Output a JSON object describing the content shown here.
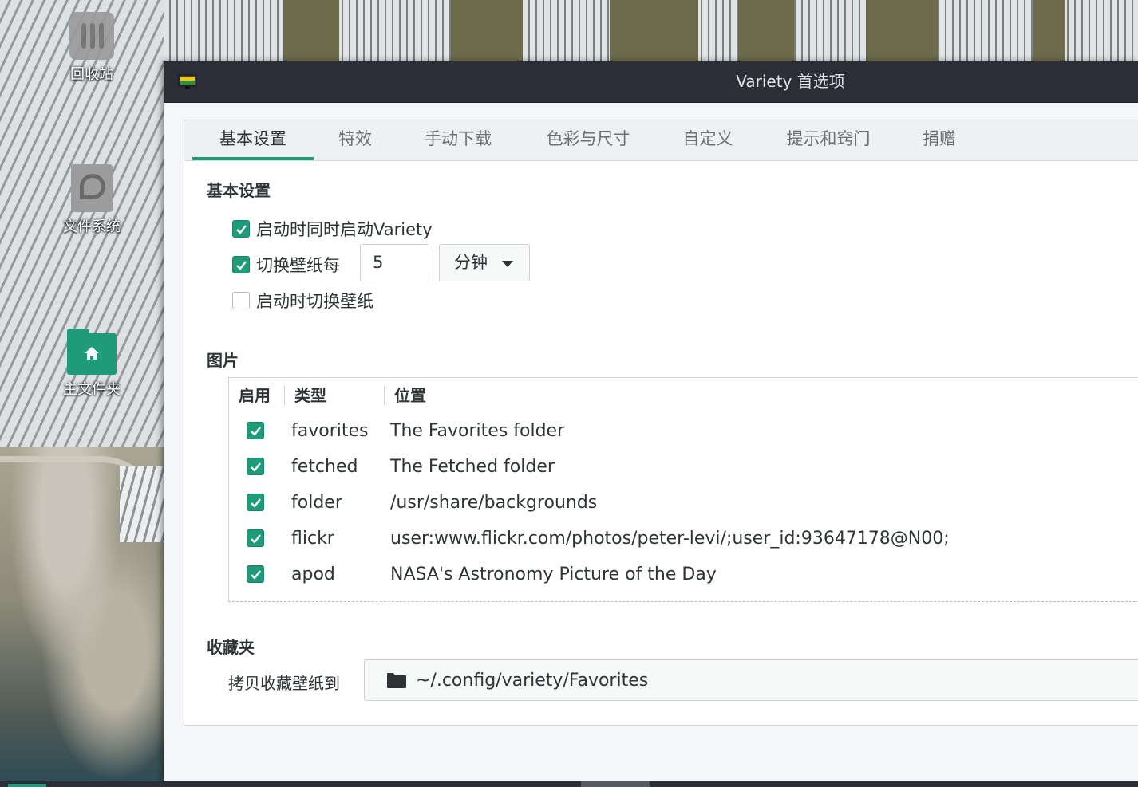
{
  "desktop": {
    "icons": [
      {
        "label": "回收站",
        "icon": "trash-icon"
      },
      {
        "label": "文件系统",
        "icon": "filesystem-icon"
      },
      {
        "label": "主文件夹",
        "icon": "home-folder-icon"
      }
    ]
  },
  "window": {
    "title": "Variety 首选项",
    "app_icon": "variety-icon"
  },
  "tabs": [
    {
      "label": "基本设置",
      "active": true
    },
    {
      "label": "特效"
    },
    {
      "label": "手动下载"
    },
    {
      "label": "色彩与尺寸"
    },
    {
      "label": "自定义"
    },
    {
      "label": "提示和窍门"
    },
    {
      "label": "捐赠"
    }
  ],
  "basic": {
    "section_title": "基本设置",
    "start_with_system": {
      "label": "启动时同时启动Variety",
      "checked": true
    },
    "change_every": {
      "label": "切换壁纸每",
      "checked": true,
      "value": "5",
      "unit": "分钟"
    },
    "change_on_start": {
      "label": "启动时切换壁纸",
      "checked": false
    }
  },
  "images": {
    "section_title": "图片",
    "columns": [
      "启用",
      "类型",
      "位置"
    ],
    "rows": [
      {
        "enabled": true,
        "type": "favorites",
        "location": "The Favorites folder"
      },
      {
        "enabled": true,
        "type": "fetched",
        "location": "The Fetched folder"
      },
      {
        "enabled": true,
        "type": "folder",
        "location": "/usr/share/backgrounds"
      },
      {
        "enabled": true,
        "type": "flickr",
        "location": "user:www.flickr.com/photos/peter-levi/;user_id:93647178@N00;"
      },
      {
        "enabled": true,
        "type": "apod",
        "location": "NASA's Astronomy Picture of the Day"
      }
    ]
  },
  "favorites": {
    "section_title": "收藏夹",
    "copy_label": "拷贝收藏壁纸到",
    "path": "~/.config/variety/Favorites",
    "icon": "folder-icon"
  },
  "colors": {
    "accent": "#1e9b78",
    "titlebar": "#2b2e37"
  }
}
